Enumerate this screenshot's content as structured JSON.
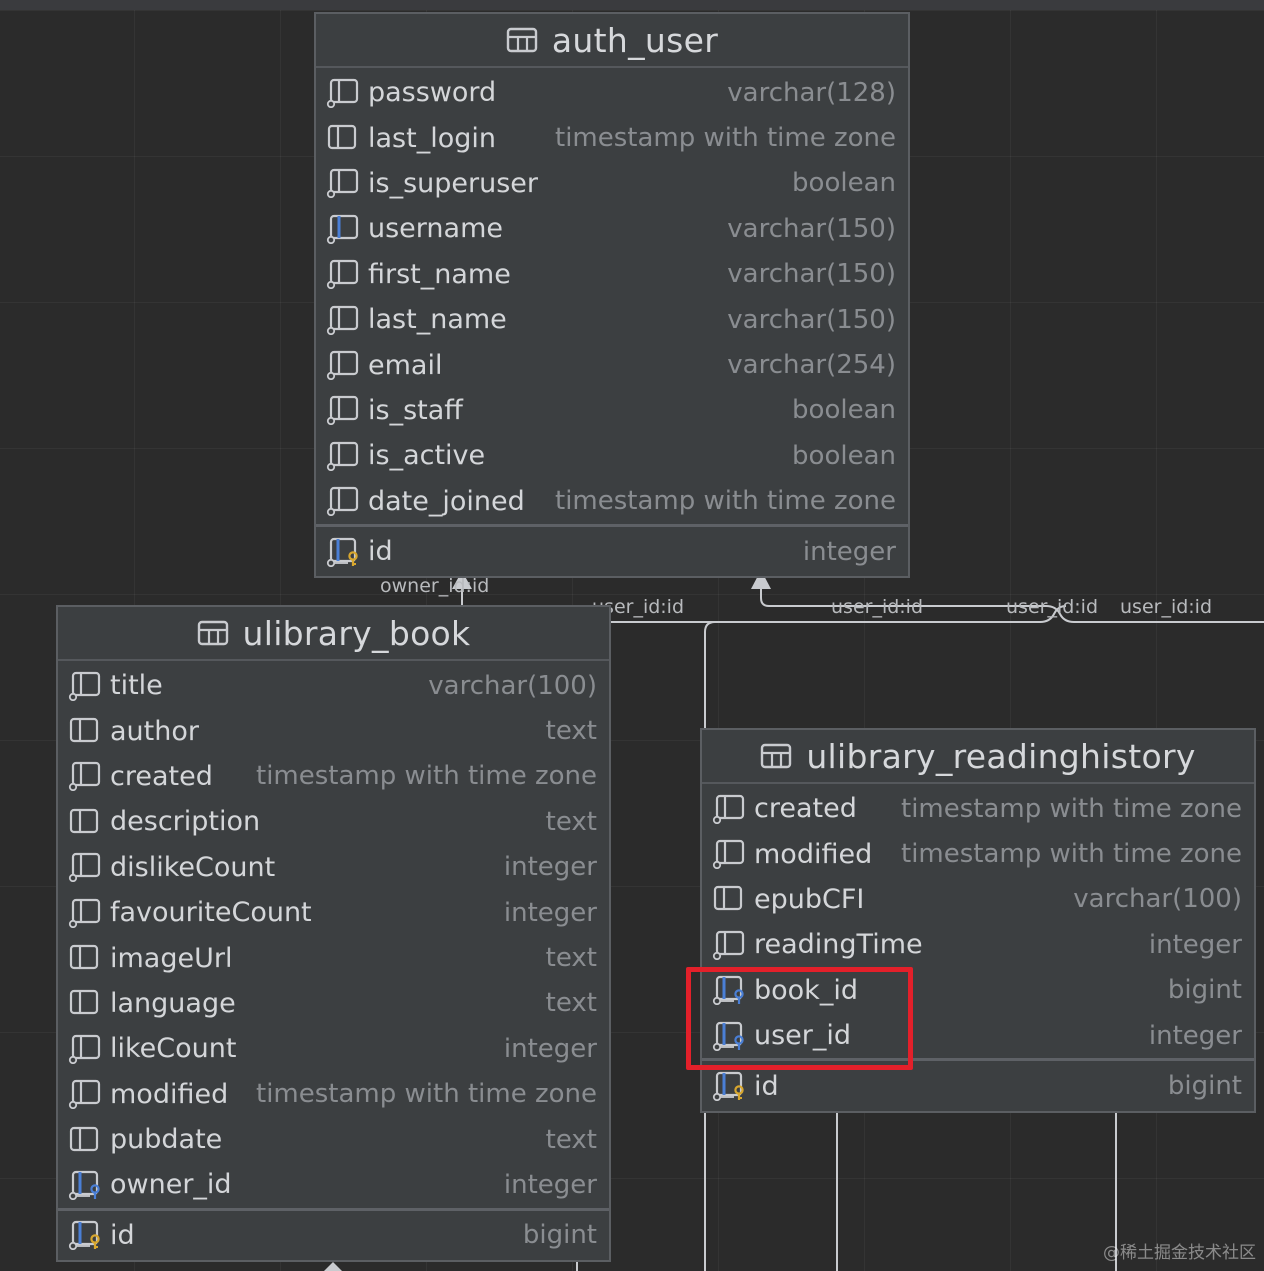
{
  "tables": {
    "auth_user": {
      "name": "auth_user",
      "columns": [
        {
          "name": "password",
          "type": "varchar(128)",
          "icon": "column-notnull-icon"
        },
        {
          "name": "last_login",
          "type": "timestamp with time zone",
          "icon": "column-icon"
        },
        {
          "name": "is_superuser",
          "type": "boolean",
          "icon": "column-notnull-icon"
        },
        {
          "name": "username",
          "type": "varchar(150)",
          "icon": "column-unique-icon"
        },
        {
          "name": "first_name",
          "type": "varchar(150)",
          "icon": "column-notnull-icon"
        },
        {
          "name": "last_name",
          "type": "varchar(150)",
          "icon": "column-notnull-icon"
        },
        {
          "name": "email",
          "type": "varchar(254)",
          "icon": "column-notnull-icon"
        },
        {
          "name": "is_staff",
          "type": "boolean",
          "icon": "column-notnull-icon"
        },
        {
          "name": "is_active",
          "type": "boolean",
          "icon": "column-notnull-icon"
        },
        {
          "name": "date_joined",
          "type": "timestamp with time zone",
          "icon": "column-notnull-icon"
        }
      ],
      "pk": {
        "name": "id",
        "type": "integer",
        "icon": "primary-key-icon"
      }
    },
    "ulibrary_book": {
      "name": "ulibrary_book",
      "columns": [
        {
          "name": "title",
          "type": "varchar(100)",
          "icon": "column-notnull-icon"
        },
        {
          "name": "author",
          "type": "text",
          "icon": "column-icon"
        },
        {
          "name": "created",
          "type": "timestamp with time zone",
          "icon": "column-notnull-icon"
        },
        {
          "name": "description",
          "type": "text",
          "icon": "column-icon"
        },
        {
          "name": "dislikeCount",
          "type": "integer",
          "icon": "column-notnull-icon"
        },
        {
          "name": "favouriteCount",
          "type": "integer",
          "icon": "column-notnull-icon"
        },
        {
          "name": "imageUrl",
          "type": "text",
          "icon": "column-icon"
        },
        {
          "name": "language",
          "type": "text",
          "icon": "column-icon"
        },
        {
          "name": "likeCount",
          "type": "integer",
          "icon": "column-notnull-icon"
        },
        {
          "name": "modified",
          "type": "timestamp with time zone",
          "icon": "column-notnull-icon"
        },
        {
          "name": "pubdate",
          "type": "text",
          "icon": "column-icon"
        },
        {
          "name": "owner_id",
          "type": "integer",
          "icon": "foreign-key-icon"
        }
      ],
      "pk": {
        "name": "id",
        "type": "bigint",
        "icon": "primary-key-icon"
      }
    },
    "ulibrary_readinghistory": {
      "name": "ulibrary_readinghistory",
      "columns": [
        {
          "name": "created",
          "type": "timestamp with time zone",
          "icon": "column-notnull-icon"
        },
        {
          "name": "modified",
          "type": "timestamp with time zone",
          "icon": "column-notnull-icon"
        },
        {
          "name": "epubCFI",
          "type": "varchar(100)",
          "icon": "column-icon"
        },
        {
          "name": "readingTime",
          "type": "integer",
          "icon": "column-notnull-icon"
        },
        {
          "name": "book_id",
          "type": "bigint",
          "icon": "foreign-key-icon"
        },
        {
          "name": "user_id",
          "type": "integer",
          "icon": "foreign-key-icon"
        }
      ],
      "pk": {
        "name": "id",
        "type": "bigint",
        "icon": "primary-key-icon"
      }
    }
  },
  "relations": {
    "owner": "owner_id:id",
    "user1": "user_id:id",
    "user2": "user_id:id",
    "user3": "user_id:id",
    "user4": "user_id:id"
  },
  "watermark": "@稀土掘金技术社区",
  "colors": {
    "background": "#2b2b2b",
    "table_bg": "#3c3f41",
    "highlight": "#e3202a",
    "key_gold": "#d8a72f",
    "key_blue": "#4a7fd6"
  }
}
